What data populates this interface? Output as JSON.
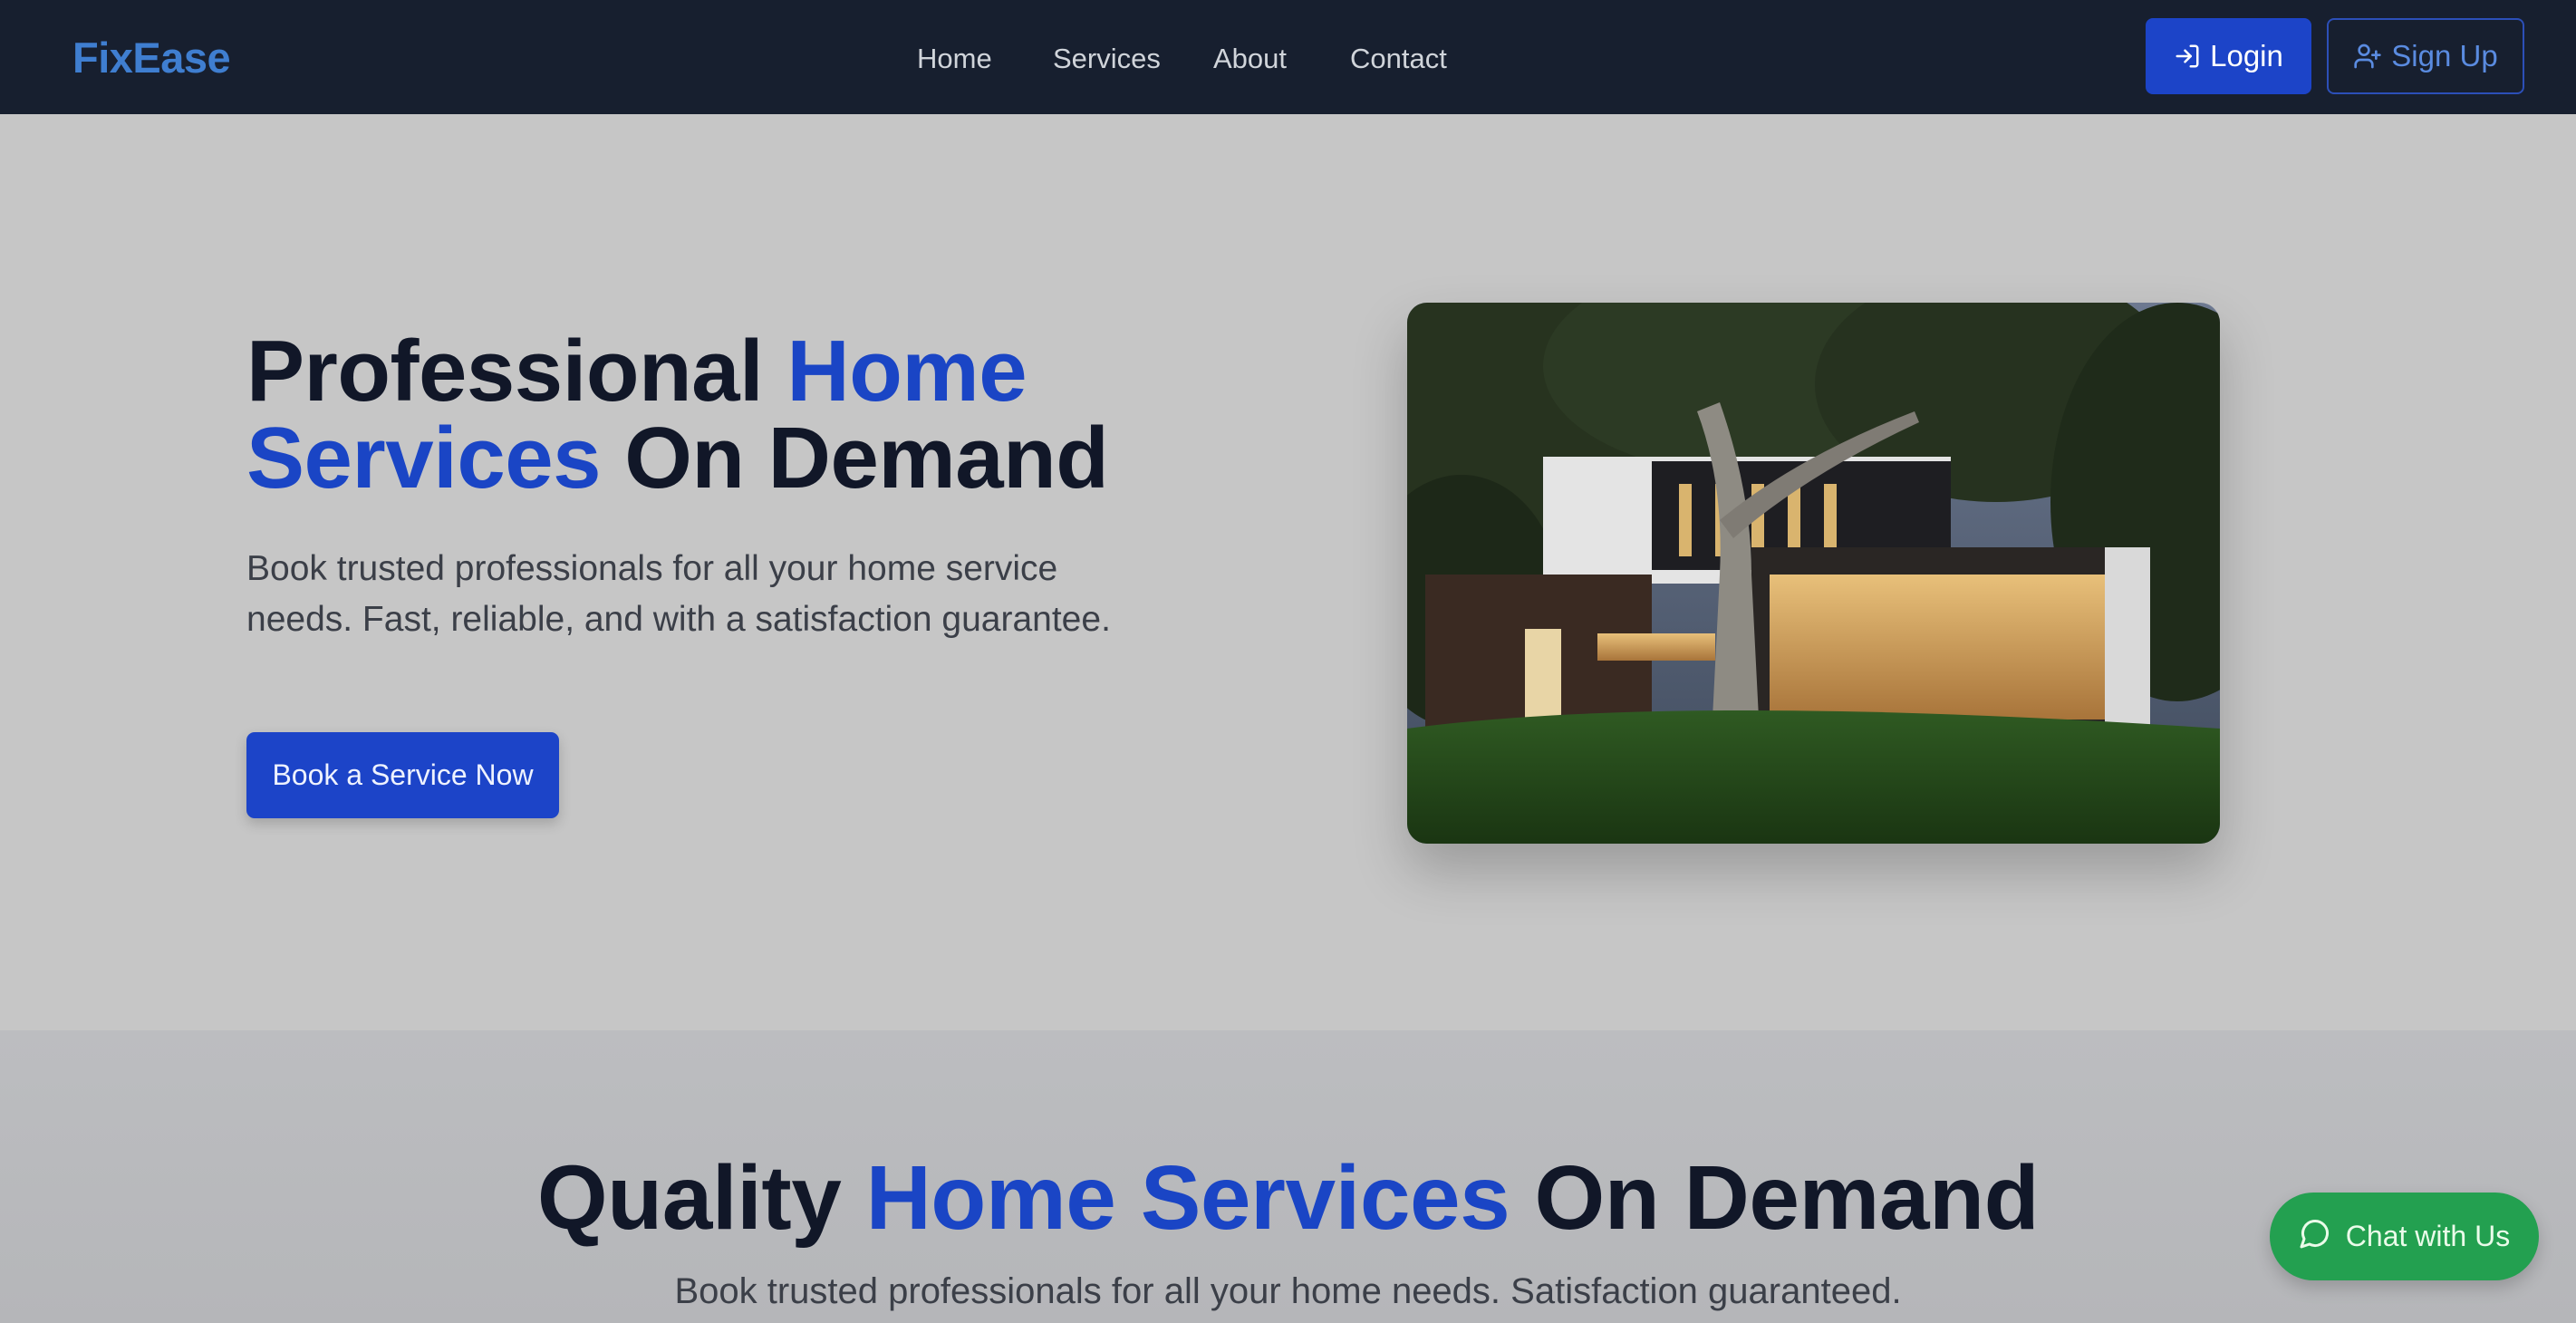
{
  "brand": {
    "name": "FixEase"
  },
  "nav": {
    "links": [
      "Home",
      "Services",
      "About",
      "Contact"
    ],
    "login_label": "Login",
    "signup_label": "Sign Up"
  },
  "hero": {
    "title_part1": "Professional ",
    "title_accent": "Home Services",
    "title_part2": " On Demand",
    "subtitle": "Book trusted professionals for all your home service needs. Fast, reliable, and with a satisfaction guarantee.",
    "cta_label": "Book a Service Now"
  },
  "section": {
    "title_part1": "Quality ",
    "title_accent": "Home Services",
    "title_part2": " On Demand",
    "subtitle": "Book trusted professionals for all your home needs. Satisfaction guaranteed."
  },
  "chat": {
    "label": "Chat with Us"
  },
  "icons": {
    "login": "login-icon",
    "signup": "user-plus-icon",
    "chat": "chat-bubble-icon"
  },
  "colors": {
    "navbar_bg": "#171f2f",
    "brand": "#3f7ed0",
    "accent": "#1a45c5",
    "primary_button": "#1c44c8",
    "chat_button": "#23a050",
    "page_bg": "#c6c6c6"
  }
}
